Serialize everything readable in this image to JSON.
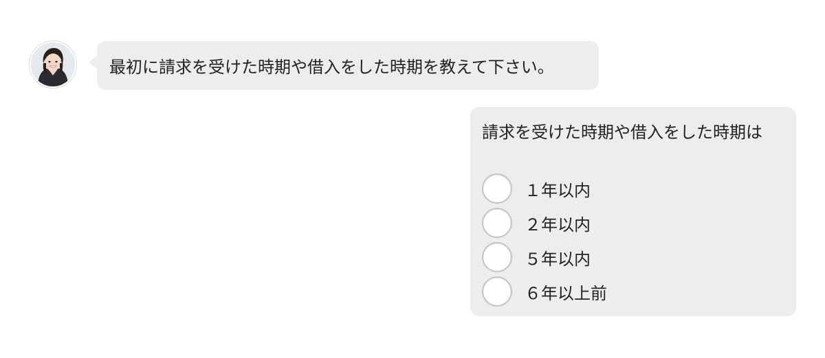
{
  "chat": {
    "agent": {
      "avatar_icon": "operator-avatar-icon",
      "message": "最初に請求を受けた時期や借入をした時期を教えて下さい。"
    },
    "reply_form": {
      "prompt": "請求を受けた時期や借入をした時期は",
      "options": [
        {
          "label": "１年以内",
          "selected": false
        },
        {
          "label": "２年以内",
          "selected": false
        },
        {
          "label": "５年以内",
          "selected": false
        },
        {
          "label": "６年以上前",
          "selected": false
        }
      ]
    }
  },
  "colors": {
    "bubble_background": "#ededed",
    "page_background": "#ffffff",
    "radio_border": "#c4c4c4",
    "text": "#222222"
  }
}
